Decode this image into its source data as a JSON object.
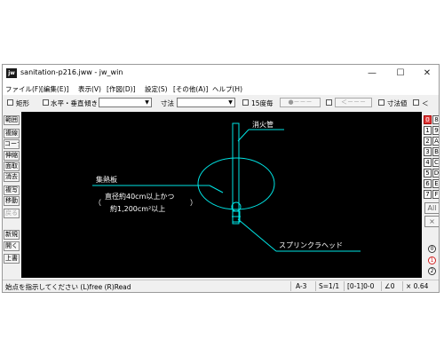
{
  "window": {
    "app_icon": "jw",
    "title": "sanitation-p216.jww - jw_win",
    "controls": [
      "—",
      "☐",
      "✕"
    ]
  },
  "menu": [
    "ファイル(F)",
    "[編集(E)]",
    "表示(V)",
    "[作図(D)]",
    "設定(S)",
    "[その他(A)]",
    "ヘルプ(H)"
  ],
  "toolbar": {
    "rect_label": "矩形",
    "hv_label": "水平・垂直",
    "tilt_label": "傾き",
    "tilt_value": "",
    "dim_label": "寸法",
    "dim_value": "",
    "deg15_label": "15度毎",
    "circle_btn": "●－－－",
    "arrow_btn": "＜－－－",
    "dimval_label": "寸法値",
    "lt_label": "＜"
  },
  "left_tools": [
    "範囲",
    "複線",
    "コーナー",
    "伸縮",
    "面取",
    "消去",
    "複写",
    "移動",
    "戻る",
    "新規",
    "開く",
    "上書"
  ],
  "right_tools": {
    "layer_rows": [
      [
        "0",
        "8"
      ],
      [
        "1",
        "9"
      ],
      [
        "2",
        "A"
      ],
      [
        "3",
        "B"
      ],
      [
        "4",
        "C"
      ],
      [
        "5",
        "D"
      ],
      [
        "6",
        "E"
      ],
      [
        "7",
        "F"
      ]
    ],
    "all_label": "All",
    "x_label": "×",
    "bottom_circles": [
      "0",
      "1",
      "2"
    ]
  },
  "drawing": {
    "pipe_label": "消火管",
    "plate_label": "集熱板",
    "note_line1": "直径約40cm以上かつ",
    "note_line2": "約1,200cm²以上",
    "paren_open": "（",
    "paren_close": "）",
    "head_label": "スプリンクラヘッド",
    "line_color": "#00e5e5"
  },
  "status": {
    "prompt": "始点を指示してください (L)free (R)Read",
    "paper": "A-3",
    "scale": "S=1/1",
    "layer": "[0-1]0-0",
    "angle": "∠0",
    "zoom": "× 0.64"
  }
}
